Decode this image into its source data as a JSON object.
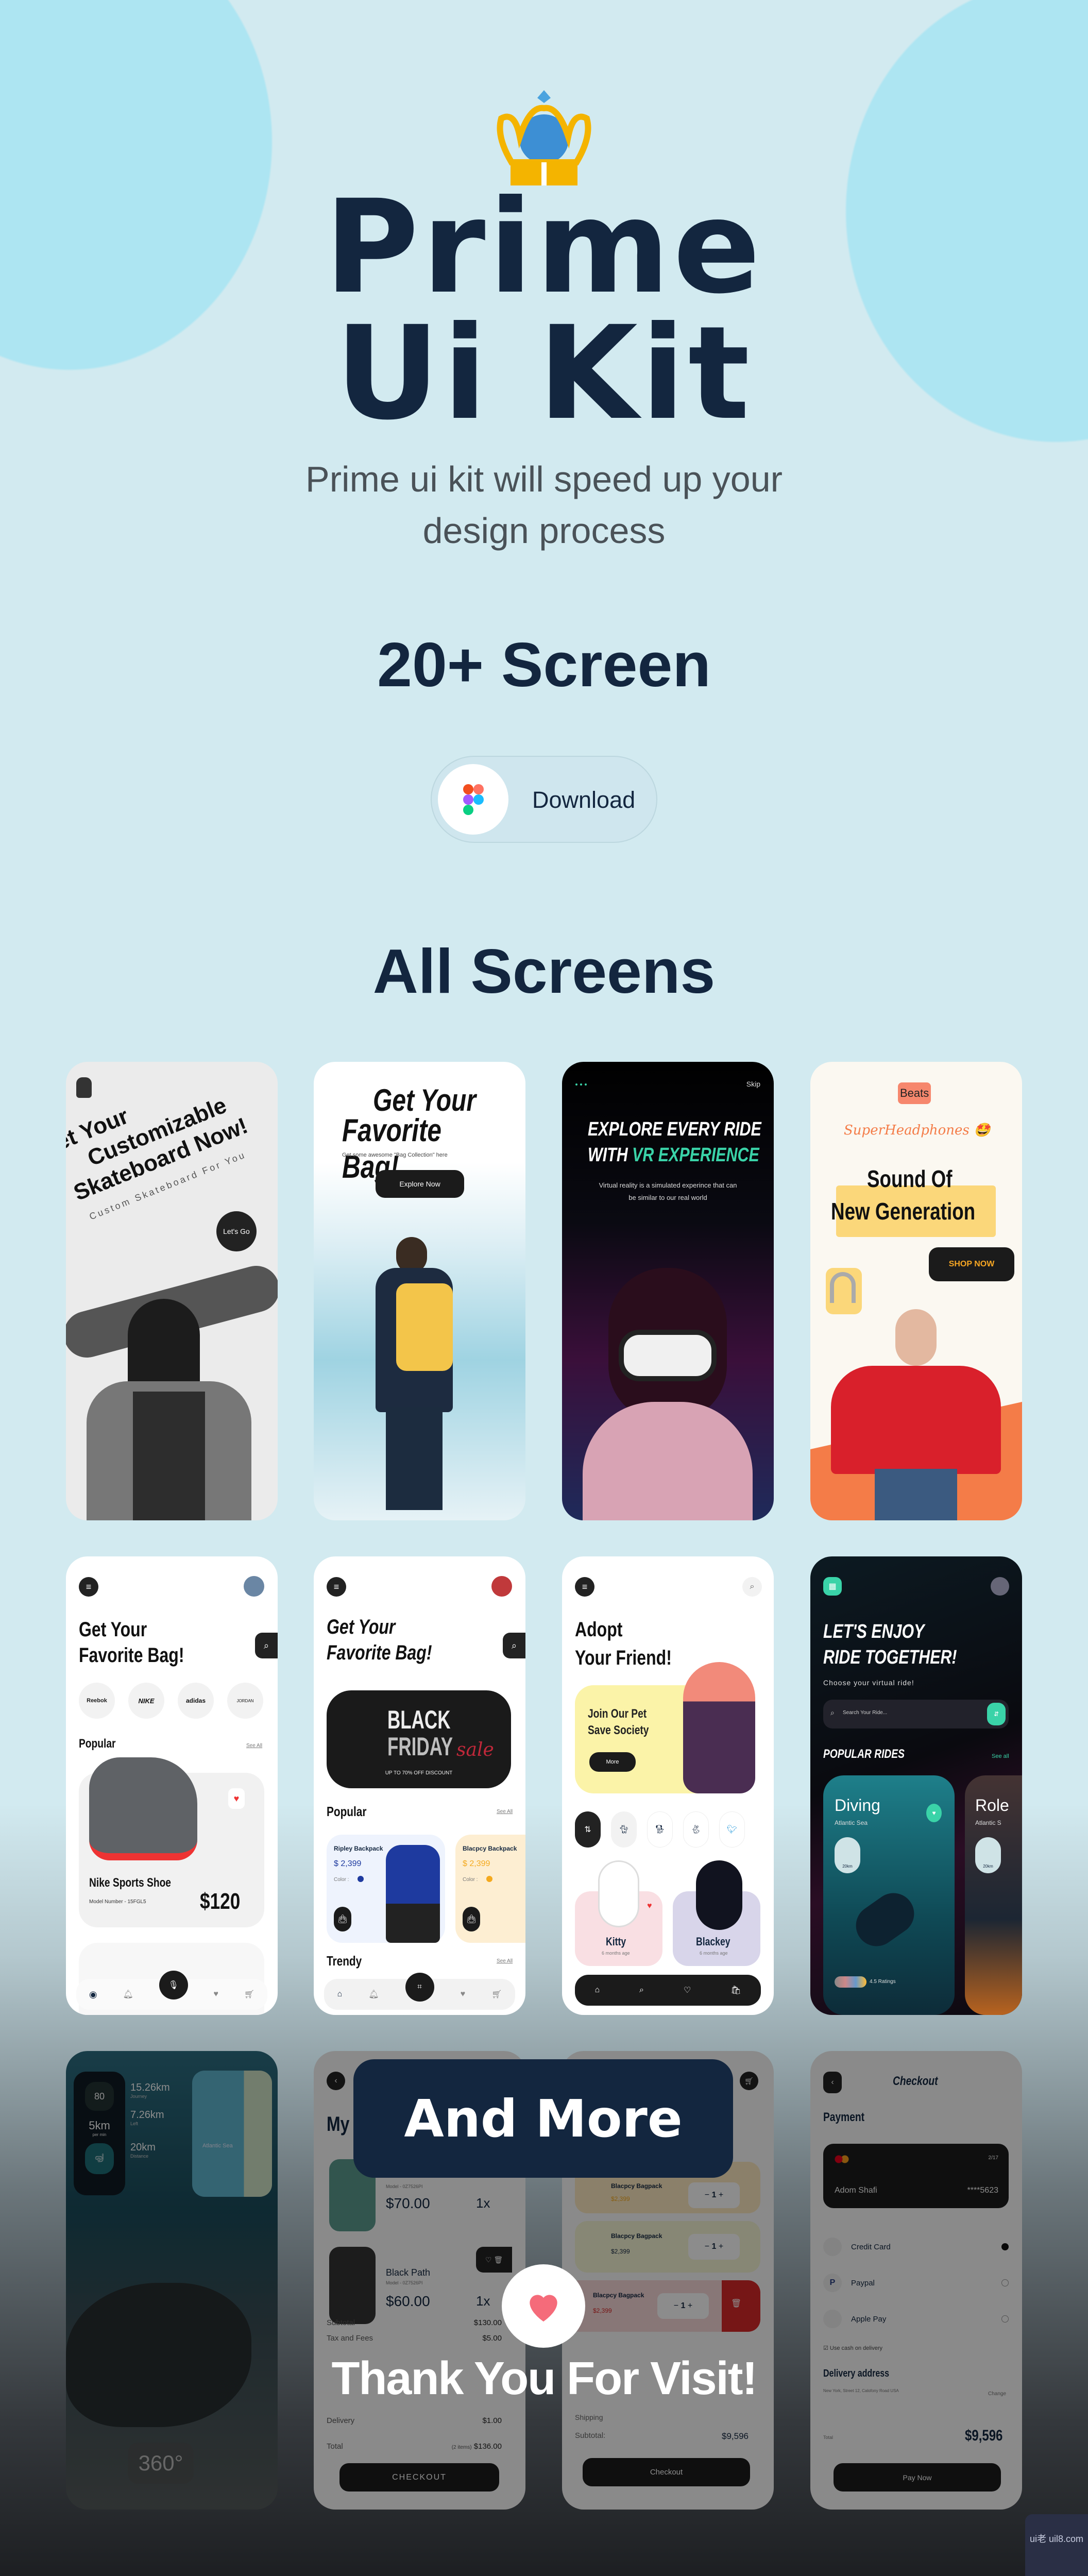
{
  "header": {
    "crown_icon": "crown-icon",
    "title_line1": "Prime",
    "title_line2": "Ui Kit",
    "subtitle_line1": "Prime ui kit will speed up your",
    "subtitle_line2": "design process",
    "screens_count": "20+ Screen",
    "download_label": "Download",
    "download_icon": "figma-icon"
  },
  "section_title": "All Screens",
  "colors": {
    "background": "#d2eaf0",
    "circles": "#ade5f2",
    "navy": "#13263f",
    "teal": "#3ad3a8",
    "orange": "#f47c48",
    "yellow": "#fbd77a"
  },
  "screens": {
    "skate": {
      "line1": "Get Your",
      "line2": "Customizable",
      "line3": "Skateboard Now!",
      "tagline": "Custom Skateboard For You",
      "cta": "Let's Go"
    },
    "bag_intro": {
      "title1": "Get Your",
      "title2": "Favorite Bag!",
      "sub": "Get some awesome \"Bag Collection\" here",
      "cta": "Explore Now"
    },
    "vr_intro": {
      "skip": "Skip",
      "title1": "EXPLORE EVERY RIDE",
      "title2a": "WITH ",
      "title2b": "VR EXPERIENCE",
      "desc1": "Virtual reality is a simulated experince that can",
      "desc2": "be similar to our real world"
    },
    "beats": {
      "brand": "Beats",
      "script": "SuperHeadphones 🤩",
      "title1": "Sound Of",
      "title2": "New Generation",
      "cta": "SHOP NOW"
    },
    "shoe_shop": {
      "title1": "Get Your",
      "title2": "Favorite Bag!",
      "brands": [
        "Reebok",
        "NIKE",
        "adidas",
        "JORDAN"
      ],
      "popular": "Popular",
      "see_all": "See All",
      "product": "Nike Sports Shoe",
      "model": "Model Number - 15FGL5",
      "price": "$120"
    },
    "bag_shop": {
      "title1": "Get Your",
      "title2": "Favorite Bag!",
      "banner1": "BLACK",
      "banner2": "FRIDAY",
      "banner3": "sale",
      "banner4": "UP TO 70% OFF DISCOUNT",
      "popular": "Popular",
      "see_all": "See All",
      "items": [
        {
          "name": "Ripley Backpack",
          "price": "$ 2,399",
          "color": "Color :"
        },
        {
          "name": "Blacpcy Backpack",
          "price": "$ 2,399",
          "color": "Color :"
        }
      ],
      "trendy": "Trendy",
      "see_all2": "See All"
    },
    "pets": {
      "title1": "Adopt",
      "title2": "Your Friend!",
      "promo1": "Join Our Pet",
      "promo2": "Save Society",
      "more": "More",
      "pets": [
        {
          "name": "Kitty",
          "age": "6 months age"
        },
        {
          "name": "Blackey",
          "age": "6 months age"
        }
      ]
    },
    "rides": {
      "title1": "LET'S ENJOY",
      "title2": "RIDE TOGETHER!",
      "sub": "Choose your virtual ride!",
      "search_placeholder": "Search Your Ride...",
      "popular": "POPULAR RIDES",
      "see_all": "See all",
      "rides": [
        {
          "name": "Diving",
          "place": "Atlantic Sea",
          "distance": "20km"
        },
        {
          "name": "Role",
          "place": "Atlantic S",
          "distance": "20km"
        }
      ],
      "ratings": "4.5 Ratings"
    },
    "dive": {
      "speed": "80",
      "pace": "5km",
      "pace_unit": "per min",
      "journey": "15.26km",
      "journey_label": "Journey",
      "left": "7.26km",
      "left_label": "Left",
      "distance": "20km",
      "distance_label": "Distance",
      "map_label": "Atlantic Sea",
      "view": "360°"
    },
    "cart": {
      "title": "My",
      "items": [
        {
          "name": "",
          "model": "Model - 0Z7526PI",
          "price": "$70.00",
          "qty": "1x"
        },
        {
          "name": "Black Path",
          "model": "Model - 0Z7526PI",
          "price": "$60.00",
          "qty": "1x"
        }
      ],
      "subtotal_label": "Subtotal",
      "subtotal": "$130.00",
      "tax_label": "Tax and Fees",
      "tax": "$5.00",
      "delivery_label": "Delivery",
      "delivery": "$1.00",
      "total_label": "Total",
      "total_items": "(2 items)",
      "total": "$136.00",
      "cta": "CHECKOUT"
    },
    "bag_cart": {
      "items": [
        {
          "name": "Blacpcy Bagpack",
          "price": "$2,399",
          "qty": "1"
        },
        {
          "name": "Blacpcy Bagpack",
          "price": "$2,399",
          "qty": "1"
        },
        {
          "name": "Blacpcy Bagpack",
          "price": "$2,399",
          "qty": "1"
        }
      ],
      "shipping_label": "Shipping",
      "subtotal_label": "Subtotal:",
      "subtotal": "$9,596",
      "cta": "Checkout"
    },
    "checkout": {
      "title": "Checkout",
      "payment": "Payment",
      "card_expiry": "2/17",
      "card_name": "Adom Shafi",
      "card_number": "****5623",
      "methods": [
        "Credit Card",
        "Paypal",
        "Apple Pay"
      ],
      "cash": "Use cash on delivery",
      "address_title": "Delivery address",
      "address": "New York, Street 12, Calofony Road USA",
      "change": "Change",
      "total_label": "Total",
      "total": "$9,596",
      "cta": "Pay Now"
    }
  },
  "footer": {
    "and_more": "And More",
    "thanks": "Thank You For Visit!",
    "heart_icon": "heart-icon",
    "watermark": "ui老 uil8.com"
  }
}
